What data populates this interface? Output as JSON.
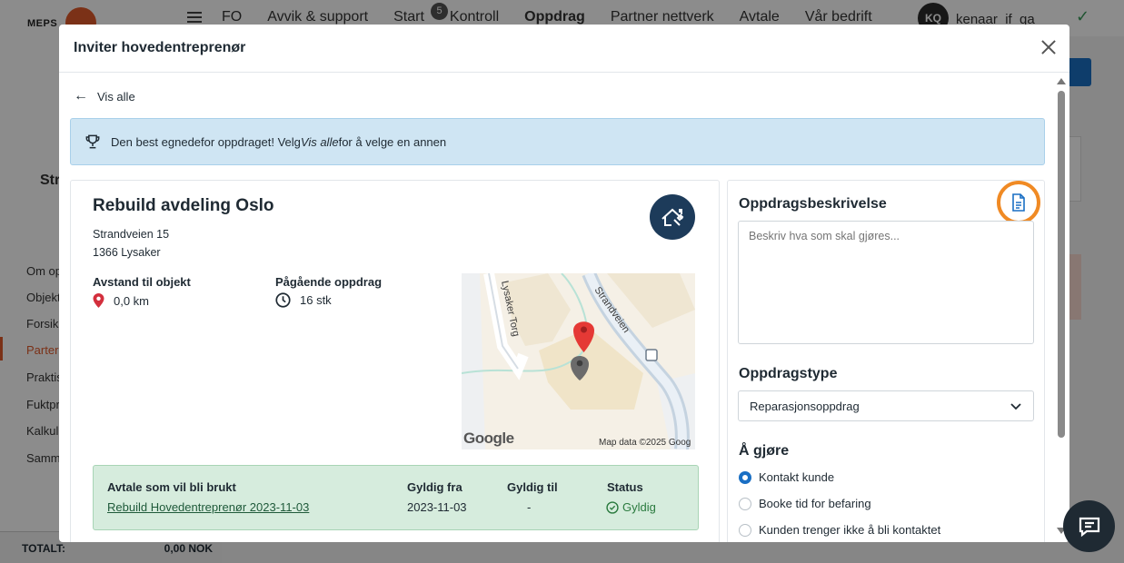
{
  "background": {
    "logo_text": "MEPS",
    "nav": {
      "item_fo": "FO",
      "item_avvik": "Avvik & support",
      "item_start": "Start",
      "start_badge": "5",
      "item_kontroll": "Kontroll",
      "item_oppdrag": "Oppdrag",
      "item_partner": "Partner nettverk",
      "item_avtale": "Avtale",
      "item_bedrift": "Vår bedrift"
    },
    "user_initials": "KQ",
    "user_name": "kenaar_if_qa",
    "sidebar": {
      "title": "Str",
      "items": [
        "Om op",
        "Objekt",
        "Forsik",
        "Parter",
        "Praktis",
        "Fuktpr",
        "Kalkul",
        "Samm"
      ]
    },
    "total_label": "TOTALT:",
    "total_value": "0,00 NOK"
  },
  "modal": {
    "title": "Inviter hovedentreprenør",
    "back_label": "Vis alle",
    "alert": {
      "text_before": "Den best egnedefor oppdraget! Velg ",
      "text_em": "Vis alle",
      "text_after": " for å velge en annen"
    },
    "object": {
      "title": "Rebuild avdeling Oslo",
      "address_line1": "Strandveien 15",
      "address_line2": "1366 Lysaker",
      "distance_label": "Avstand til objekt",
      "distance_value": "0,0 km",
      "ongoing_label": "Pågående oppdrag",
      "ongoing_value": "16 stk",
      "map": {
        "street_1": "Lysaker Torg",
        "street_2": "Strandveien",
        "google": "Google",
        "credit": "Map data ©2025 Goog"
      }
    },
    "agreement": {
      "col_agreement": "Avtale som vil bli brukt",
      "col_from": "Gyldig fra",
      "col_to": "Gyldig til",
      "col_status": "Status",
      "name": "Rebuild Hovedentreprenør 2023-11-03",
      "from": "2023-11-03",
      "to": "-",
      "status": "Gyldig"
    },
    "assignment": {
      "description_heading": "Oppdragsbeskrivelse",
      "description_placeholder": "Beskriv hva som skal gjøres...",
      "type_heading": "Oppdragstype",
      "type_selected": "Reparasjonsoppdrag",
      "todo_heading": "Å gjøre",
      "todo_options": [
        {
          "label": "Kontakt kunde",
          "checked": true
        },
        {
          "label": "Booke tid for befaring",
          "checked": false
        },
        {
          "label": "Kunden trenger ikke å bli kontaktet",
          "checked": false
        }
      ]
    }
  },
  "colors": {
    "accent_blue": "#1a6fc4",
    "highlight_orange": "#f08a24",
    "success_green": "#2a7a3e",
    "map_pin_red": "#e53935",
    "object_logo_navy": "#1d3b5a"
  }
}
